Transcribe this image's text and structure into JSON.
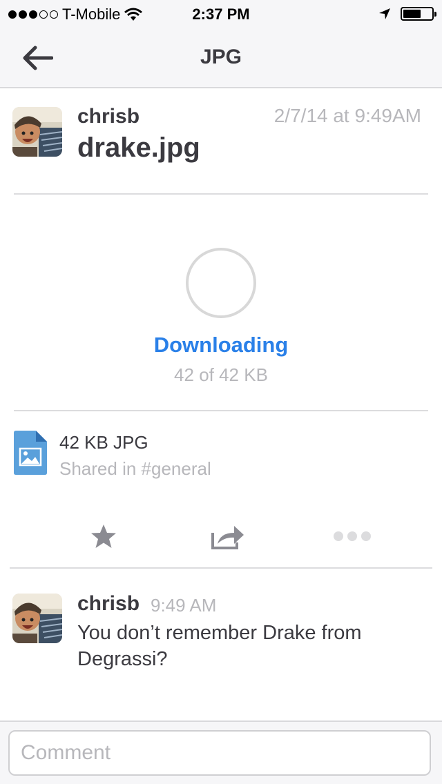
{
  "status_bar": {
    "carrier": "T-Mobile",
    "time": "2:37 PM",
    "signal_icon": "signal-dots-icon",
    "wifi_icon": "wifi-icon",
    "location_icon": "location-arrow-icon",
    "battery_icon": "battery-icon"
  },
  "nav": {
    "back_icon": "back-arrow-icon",
    "title": "JPG"
  },
  "file": {
    "uploader": "chrisb",
    "date": "2/7/14 at 9:49AM",
    "name": "drake.jpg",
    "download_status": "Downloading",
    "download_progress": "42 of 42 KB",
    "meta": "42 KB JPG",
    "shared_in": "Shared in #general",
    "file_icon": "image-file-icon"
  },
  "actions": {
    "star_icon": "star-icon",
    "share_icon": "share-icon",
    "more_icon": "more-dots-icon"
  },
  "comment": {
    "user": "chrisb",
    "time": "9:49 AM",
    "text": "You don’t remember Drake from Degrassi?"
  },
  "comment_input": {
    "placeholder": "Comment"
  },
  "colors": {
    "accent": "#2a80e8",
    "muted_text": "#b7b7bb",
    "primary_text": "#3b3a40",
    "icon": "#8b8b92"
  }
}
